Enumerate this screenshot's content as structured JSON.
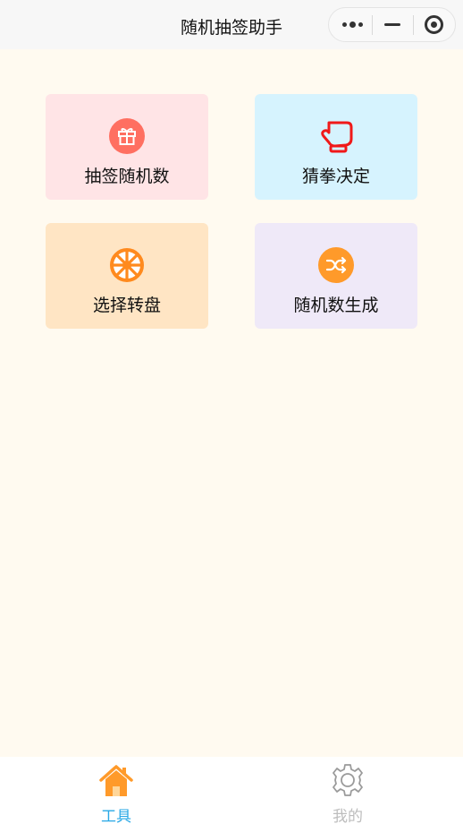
{
  "nav": {
    "title": "随机抽签助手"
  },
  "cards": [
    {
      "label": "抽签随机数",
      "bg": "#ffe4e6",
      "icon": "gift-icon",
      "icon_color": "#ff6f61"
    },
    {
      "label": "猜拳决定",
      "bg": "#d6f3fe",
      "icon": "boxing-glove-icon",
      "icon_color": "#f01919"
    },
    {
      "label": "选择转盘",
      "bg": "#ffe5c4",
      "icon": "wheel-icon",
      "icon_color": "#ff8a1e"
    },
    {
      "label": "随机数生成",
      "bg": "#efe9f8",
      "icon": "shuffle-icon",
      "icon_color": "#ff9a2a"
    }
  ],
  "tabbar": {
    "items": [
      {
        "label": "工具",
        "icon": "home-icon",
        "color": "#29a8e6",
        "active": true
      },
      {
        "label": "我的",
        "icon": "gear-icon",
        "color": "#bdbdbd",
        "active": false
      }
    ]
  }
}
